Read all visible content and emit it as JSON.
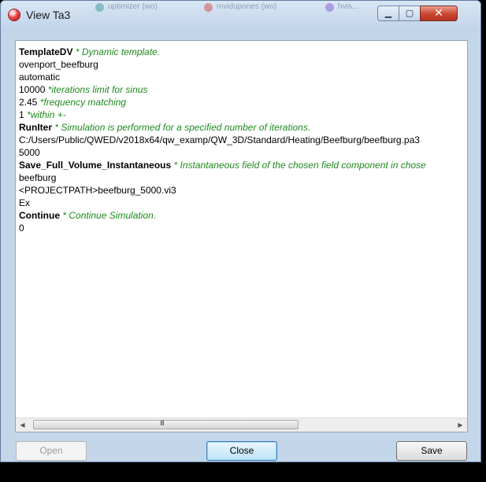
{
  "window": {
    "title": "View Ta3",
    "controls": {
      "minimize": "▁",
      "maximize": "▢",
      "close": "✕"
    },
    "background_tabs": [
      {
        "label": "uptimizer (wo)",
        "color": "#2f8f9d"
      },
      {
        "label": "mvidupones (wo)",
        "color": "#d23a3a"
      },
      {
        "label": "hvis...",
        "color": "#7b4bd1"
      }
    ]
  },
  "content": {
    "lines": [
      {
        "keyword": "TemplateDV",
        "text": "",
        "comment": "* Dynamic template."
      },
      {
        "keyword": "",
        "text": "ovenport_beefburg",
        "comment": ""
      },
      {
        "keyword": "",
        "text": "automatic",
        "comment": ""
      },
      {
        "keyword": "",
        "text": "10000",
        "comment": "*iterations limit for sinus"
      },
      {
        "keyword": "",
        "text": "2.45",
        "comment": "*frequency matching"
      },
      {
        "keyword": "",
        "text": "1",
        "comment": "*within +-"
      },
      {
        "keyword": "RunIter",
        "text": "",
        "comment": "* Simulation is performed for a specified number of iterations."
      },
      {
        "keyword": "",
        "text": "C:/Users/Public/QWED/v2018x64/qw_examp/QW_3D/Standard/Heating/Beefburg/beefburg.pa3",
        "comment": ""
      },
      {
        "keyword": "",
        "text": "5000",
        "comment": ""
      },
      {
        "keyword": "Save_Full_Volume_Instantaneous",
        "text": "",
        "comment": "* Instantaneous field of the chosen field component in chose"
      },
      {
        "keyword": "",
        "text": "beefburg",
        "comment": ""
      },
      {
        "keyword": "",
        "text": "<PROJECTPATH>beefburg_5000.vi3",
        "comment": ""
      },
      {
        "keyword": "",
        "text": "Ex",
        "comment": ""
      },
      {
        "keyword": "Continue",
        "text": "",
        "comment": "* Continue Simulation."
      },
      {
        "keyword": "",
        "text": "0",
        "comment": ""
      }
    ]
  },
  "scrollbar": {
    "left_arrow": "◀",
    "right_arrow": "▶",
    "grip": "III"
  },
  "buttons": {
    "open": "Open",
    "close": "Close",
    "save": "Save"
  },
  "colors": {
    "comment": "#1e8a1e",
    "close_button": "#c8452f"
  }
}
